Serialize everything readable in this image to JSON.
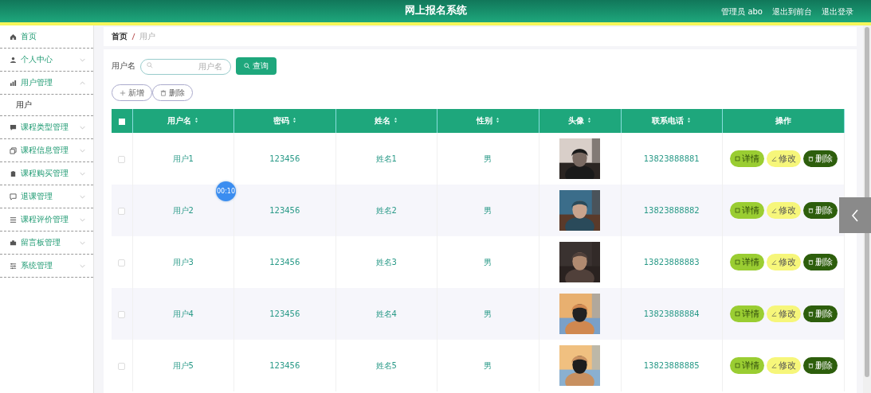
{
  "header": {
    "title": "网上报名系统",
    "links": [
      "管理员 abo",
      "退出到前台",
      "退出登录"
    ]
  },
  "sidebar": {
    "items": [
      {
        "label": "首页"
      },
      {
        "label": "个人中心",
        "expanded": false
      },
      {
        "label": "用户管理",
        "expanded": true,
        "children": [
          {
            "label": "用户"
          }
        ]
      },
      {
        "label": "课程类型管理",
        "expanded": false
      },
      {
        "label": "课程信息管理",
        "expanded": false
      },
      {
        "label": "课程购买管理",
        "expanded": false
      },
      {
        "label": "退课管理",
        "expanded": false
      },
      {
        "label": "课程评价管理",
        "expanded": false
      },
      {
        "label": "留言板管理",
        "expanded": false
      },
      {
        "label": "系统管理",
        "expanded": false
      }
    ]
  },
  "breadcrumb": [
    "首页",
    "用户"
  ],
  "search": {
    "label": "用户名",
    "placeholder": "用户名",
    "button": "查询"
  },
  "actions": [
    {
      "label": "新增",
      "kind": "add"
    },
    {
      "label": "删除",
      "kind": "delete"
    }
  ],
  "table": {
    "select_all_checked": false,
    "columns": [
      {
        "label": "用户名",
        "sortable": true
      },
      {
        "label": "密码",
        "sortable": true
      },
      {
        "label": "姓名",
        "sortable": true
      },
      {
        "label": "性别",
        "sortable": true
      },
      {
        "label": "头像",
        "sortable": true
      },
      {
        "label": "联系电话",
        "sortable": true
      },
      {
        "label": "操作",
        "sortable": false
      }
    ],
    "rows": [
      {
        "checked": false,
        "username": "用户1",
        "password": "123456",
        "name": "姓名1",
        "gender": "男",
        "phone": "13823888881",
        "buttons": [
          {
            "label": "详情",
            "kind": "detail"
          },
          {
            "label": "修改",
            "kind": "edit"
          },
          {
            "label": "删除",
            "kind": "delete"
          }
        ]
      },
      {
        "checked": false,
        "username": "用户2",
        "password": "123456",
        "name": "姓名2",
        "gender": "男",
        "phone": "13823888882",
        "buttons": [
          {
            "label": "详情",
            "kind": "detail"
          },
          {
            "label": "修改",
            "kind": "edit"
          },
          {
            "label": "删除",
            "kind": "delete"
          }
        ]
      },
      {
        "checked": false,
        "username": "用户3",
        "password": "123456",
        "name": "姓名3",
        "gender": "男",
        "phone": "13823888883",
        "buttons": [
          {
            "label": "详情",
            "kind": "detail"
          },
          {
            "label": "修改",
            "kind": "edit"
          },
          {
            "label": "删除",
            "kind": "delete"
          }
        ]
      },
      {
        "checked": false,
        "username": "用户4",
        "password": "123456",
        "name": "姓名4",
        "gender": "男",
        "phone": "13823888884",
        "buttons": [
          {
            "label": "详情",
            "kind": "detail"
          },
          {
            "label": "修改",
            "kind": "edit"
          },
          {
            "label": "删除",
            "kind": "delete"
          }
        ]
      },
      {
        "checked": false,
        "username": "用户5",
        "password": "123456",
        "name": "姓名5",
        "gender": "男",
        "phone": "13823888885",
        "buttons": [
          {
            "label": "详情",
            "kind": "detail"
          },
          {
            "label": "修改",
            "kind": "edit"
          },
          {
            "label": "删除",
            "kind": "delete"
          }
        ]
      }
    ]
  },
  "timer": "00:10"
}
